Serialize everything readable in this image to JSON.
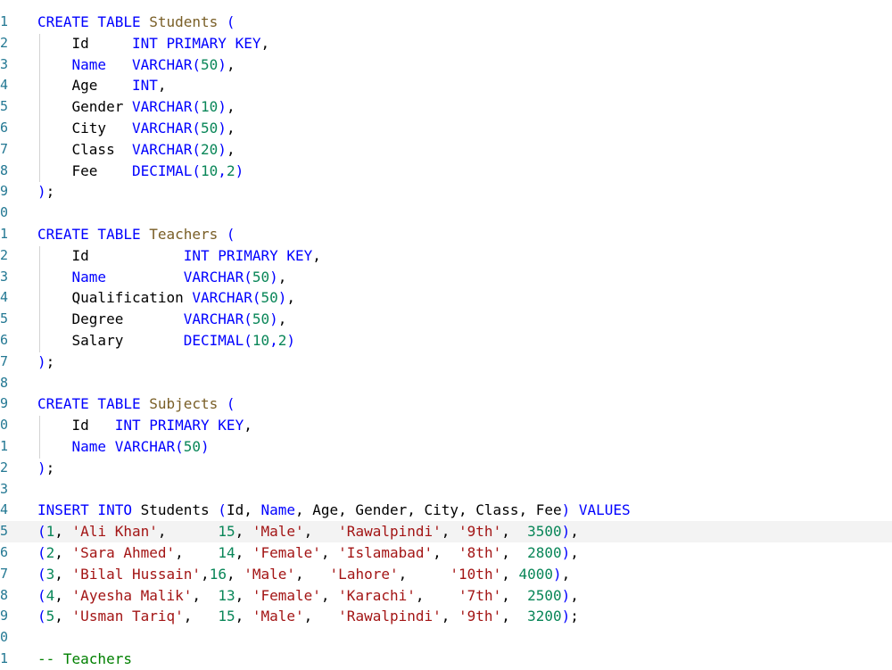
{
  "editor": {
    "colors": {
      "keyword": "#0000ff",
      "table_name": "#795e26",
      "string": "#a31515",
      "number": "#098658",
      "comment": "#008000",
      "line_number": "#237893",
      "current_line_bg": "#f3f3f3"
    },
    "current_line": 25,
    "lines": [
      {
        "n": "1",
        "tokens": [
          {
            "t": "CREATE TABLE ",
            "c": "kw"
          },
          {
            "t": "Students",
            "c": "tbl"
          },
          {
            "t": " (",
            "c": "kw"
          }
        ]
      },
      {
        "n": "2",
        "tokens": [
          {
            "t": "    Id     "
          },
          {
            "t": "INT PRIMARY KEY",
            "c": "kw"
          },
          {
            "t": ","
          }
        ]
      },
      {
        "n": "3",
        "tokens": [
          {
            "t": "    "
          },
          {
            "t": "Name",
            "c": "kw"
          },
          {
            "t": "   "
          },
          {
            "t": "VARCHAR(",
            "c": "kw"
          },
          {
            "t": "50",
            "c": "num"
          },
          {
            "t": ")",
            "c": "kw"
          },
          {
            "t": ","
          }
        ]
      },
      {
        "n": "4",
        "tokens": [
          {
            "t": "    Age    "
          },
          {
            "t": "INT",
            "c": "kw"
          },
          {
            "t": ","
          }
        ]
      },
      {
        "n": "5",
        "tokens": [
          {
            "t": "    Gender "
          },
          {
            "t": "VARCHAR(",
            "c": "kw"
          },
          {
            "t": "10",
            "c": "num"
          },
          {
            "t": ")",
            "c": "kw"
          },
          {
            "t": ","
          }
        ]
      },
      {
        "n": "6",
        "tokens": [
          {
            "t": "    City   "
          },
          {
            "t": "VARCHAR(",
            "c": "kw"
          },
          {
            "t": "50",
            "c": "num"
          },
          {
            "t": ")",
            "c": "kw"
          },
          {
            "t": ","
          }
        ]
      },
      {
        "n": "7",
        "tokens": [
          {
            "t": "    Class  "
          },
          {
            "t": "VARCHAR(",
            "c": "kw"
          },
          {
            "t": "20",
            "c": "num"
          },
          {
            "t": ")",
            "c": "kw"
          },
          {
            "t": ","
          }
        ]
      },
      {
        "n": "8",
        "tokens": [
          {
            "t": "    Fee    "
          },
          {
            "t": "DECIMAL(",
            "c": "kw"
          },
          {
            "t": "10",
            "c": "num"
          },
          {
            "t": ",",
            "c": "kw"
          },
          {
            "t": "2",
            "c": "num"
          },
          {
            "t": ")",
            "c": "kw"
          }
        ]
      },
      {
        "n": "9",
        "tokens": [
          {
            "t": ")",
            "c": "kw"
          },
          {
            "t": ";"
          }
        ]
      },
      {
        "n": "0",
        "tokens": []
      },
      {
        "n": "1",
        "tokens": [
          {
            "t": "CREATE TABLE ",
            "c": "kw"
          },
          {
            "t": "Teachers",
            "c": "tbl"
          },
          {
            "t": " (",
            "c": "kw"
          }
        ]
      },
      {
        "n": "2",
        "tokens": [
          {
            "t": "    Id           "
          },
          {
            "t": "INT PRIMARY KEY",
            "c": "kw"
          },
          {
            "t": ","
          }
        ]
      },
      {
        "n": "3",
        "tokens": [
          {
            "t": "    "
          },
          {
            "t": "Name",
            "c": "kw"
          },
          {
            "t": "         "
          },
          {
            "t": "VARCHAR(",
            "c": "kw"
          },
          {
            "t": "50",
            "c": "num"
          },
          {
            "t": ")",
            "c": "kw"
          },
          {
            "t": ","
          }
        ]
      },
      {
        "n": "4",
        "tokens": [
          {
            "t": "    Qualification "
          },
          {
            "t": "VARCHAR(",
            "c": "kw"
          },
          {
            "t": "50",
            "c": "num"
          },
          {
            "t": ")",
            "c": "kw"
          },
          {
            "t": ","
          }
        ]
      },
      {
        "n": "5",
        "tokens": [
          {
            "t": "    Degree       "
          },
          {
            "t": "VARCHAR(",
            "c": "kw"
          },
          {
            "t": "50",
            "c": "num"
          },
          {
            "t": ")",
            "c": "kw"
          },
          {
            "t": ","
          }
        ]
      },
      {
        "n": "6",
        "tokens": [
          {
            "t": "    Salary       "
          },
          {
            "t": "DECIMAL(",
            "c": "kw"
          },
          {
            "t": "10",
            "c": "num"
          },
          {
            "t": ",",
            "c": "kw"
          },
          {
            "t": "2",
            "c": "num"
          },
          {
            "t": ")",
            "c": "kw"
          }
        ]
      },
      {
        "n": "7",
        "tokens": [
          {
            "t": ")",
            "c": "kw"
          },
          {
            "t": ";"
          }
        ]
      },
      {
        "n": "8",
        "tokens": []
      },
      {
        "n": "9",
        "tokens": [
          {
            "t": "CREATE TABLE ",
            "c": "kw"
          },
          {
            "t": "Subjects",
            "c": "tbl"
          },
          {
            "t": " (",
            "c": "kw"
          }
        ]
      },
      {
        "n": "0",
        "tokens": [
          {
            "t": "    Id   "
          },
          {
            "t": "INT PRIMARY KEY",
            "c": "kw"
          },
          {
            "t": ","
          }
        ]
      },
      {
        "n": "1",
        "tokens": [
          {
            "t": "    "
          },
          {
            "t": "Name",
            "c": "kw"
          },
          {
            "t": " "
          },
          {
            "t": "VARCHAR(",
            "c": "kw"
          },
          {
            "t": "50",
            "c": "num"
          },
          {
            "t": ")",
            "c": "kw"
          }
        ]
      },
      {
        "n": "2",
        "tokens": [
          {
            "t": ")",
            "c": "kw"
          },
          {
            "t": ";"
          }
        ]
      },
      {
        "n": "3",
        "tokens": []
      },
      {
        "n": "4",
        "tokens": [
          {
            "t": "INSERT INTO ",
            "c": "kw"
          },
          {
            "t": "Students "
          },
          {
            "t": "(",
            "c": "kw"
          },
          {
            "t": "Id, "
          },
          {
            "t": "Name",
            "c": "kw"
          },
          {
            "t": ", Age, Gender, City, Class, Fee"
          },
          {
            "t": ") VALUES",
            "c": "kw"
          }
        ]
      },
      {
        "n": "5",
        "tokens": [
          {
            "t": "(",
            "c": "kw"
          },
          {
            "t": "1",
            "c": "num"
          },
          {
            "t": ", "
          },
          {
            "t": "'Ali Khan'",
            "c": "str"
          },
          {
            "t": ",      "
          },
          {
            "t": "15",
            "c": "num"
          },
          {
            "t": ", "
          },
          {
            "t": "'Male'",
            "c": "str"
          },
          {
            "t": ",   "
          },
          {
            "t": "'Rawalpindi'",
            "c": "str"
          },
          {
            "t": ", "
          },
          {
            "t": "'9th'",
            "c": "str"
          },
          {
            "t": ",  "
          },
          {
            "t": "3500",
            "c": "num"
          },
          {
            "t": ")",
            "c": "kw"
          },
          {
            "t": ","
          }
        ]
      },
      {
        "n": "6",
        "tokens": [
          {
            "t": "(",
            "c": "kw"
          },
          {
            "t": "2",
            "c": "num"
          },
          {
            "t": ", "
          },
          {
            "t": "'Sara Ahmed'",
            "c": "str"
          },
          {
            "t": ",    "
          },
          {
            "t": "14",
            "c": "num"
          },
          {
            "t": ", "
          },
          {
            "t": "'Female'",
            "c": "str"
          },
          {
            "t": ", "
          },
          {
            "t": "'Islamabad'",
            "c": "str"
          },
          {
            "t": ",  "
          },
          {
            "t": "'8th'",
            "c": "str"
          },
          {
            "t": ",  "
          },
          {
            "t": "2800",
            "c": "num"
          },
          {
            "t": ")",
            "c": "kw"
          },
          {
            "t": ","
          }
        ]
      },
      {
        "n": "7",
        "tokens": [
          {
            "t": "(",
            "c": "kw"
          },
          {
            "t": "3",
            "c": "num"
          },
          {
            "t": ", "
          },
          {
            "t": "'Bilal Hussain'",
            "c": "str"
          },
          {
            "t": ","
          },
          {
            "t": "16",
            "c": "num"
          },
          {
            "t": ", "
          },
          {
            "t": "'Male'",
            "c": "str"
          },
          {
            "t": ",   "
          },
          {
            "t": "'Lahore'",
            "c": "str"
          },
          {
            "t": ",     "
          },
          {
            "t": "'10th'",
            "c": "str"
          },
          {
            "t": ", "
          },
          {
            "t": "4000",
            "c": "num"
          },
          {
            "t": ")",
            "c": "kw"
          },
          {
            "t": ","
          }
        ]
      },
      {
        "n": "8",
        "tokens": [
          {
            "t": "(",
            "c": "kw"
          },
          {
            "t": "4",
            "c": "num"
          },
          {
            "t": ", "
          },
          {
            "t": "'Ayesha Malik'",
            "c": "str"
          },
          {
            "t": ",  "
          },
          {
            "t": "13",
            "c": "num"
          },
          {
            "t": ", "
          },
          {
            "t": "'Female'",
            "c": "str"
          },
          {
            "t": ", "
          },
          {
            "t": "'Karachi'",
            "c": "str"
          },
          {
            "t": ",    "
          },
          {
            "t": "'7th'",
            "c": "str"
          },
          {
            "t": ",  "
          },
          {
            "t": "2500",
            "c": "num"
          },
          {
            "t": ")",
            "c": "kw"
          },
          {
            "t": ","
          }
        ]
      },
      {
        "n": "9",
        "tokens": [
          {
            "t": "(",
            "c": "kw"
          },
          {
            "t": "5",
            "c": "num"
          },
          {
            "t": ", "
          },
          {
            "t": "'Usman Tariq'",
            "c": "str"
          },
          {
            "t": ",   "
          },
          {
            "t": "15",
            "c": "num"
          },
          {
            "t": ", "
          },
          {
            "t": "'Male'",
            "c": "str"
          },
          {
            "t": ",   "
          },
          {
            "t": "'Rawalpindi'",
            "c": "str"
          },
          {
            "t": ", "
          },
          {
            "t": "'9th'",
            "c": "str"
          },
          {
            "t": ",  "
          },
          {
            "t": "3200",
            "c": "num"
          },
          {
            "t": ")",
            "c": "kw"
          },
          {
            "t": ";"
          }
        ]
      },
      {
        "n": "0",
        "tokens": []
      },
      {
        "n": "1",
        "tokens": [
          {
            "t": "-- Teachers",
            "c": "cmt"
          }
        ]
      }
    ]
  }
}
